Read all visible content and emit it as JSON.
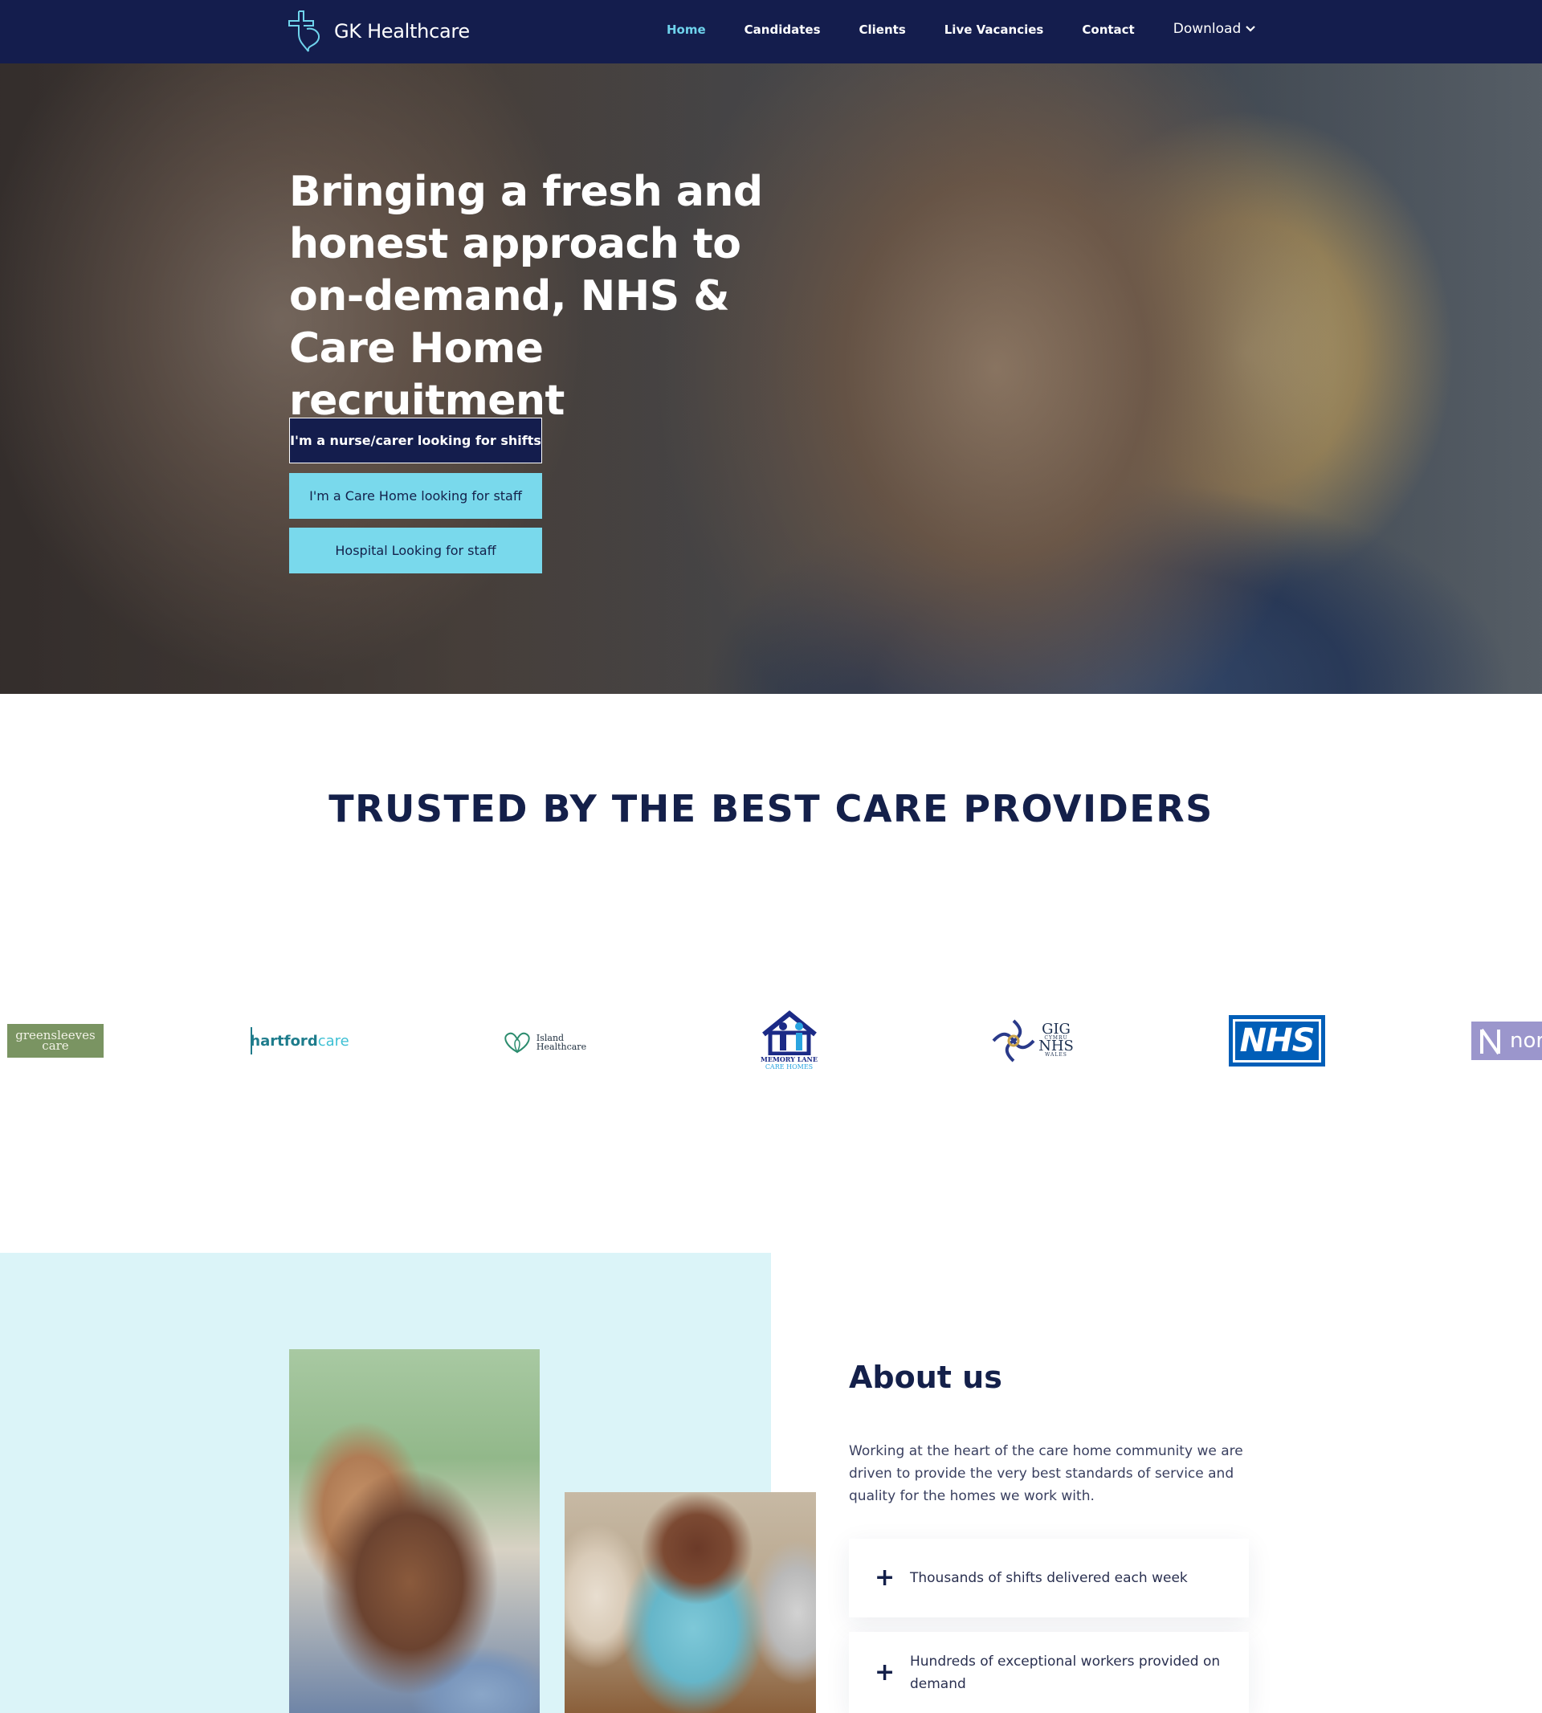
{
  "nav": {
    "brand": "GK Healthcare",
    "items": [
      {
        "label": "Home",
        "active": true
      },
      {
        "label": "Candidates"
      },
      {
        "label": "Clients"
      },
      {
        "label": "Live Vacancies"
      },
      {
        "label": "Contact"
      }
    ],
    "download": "Download",
    "icons": {
      "logo": "caduceus-cross-icon",
      "dropdown": "chevron-down-icon"
    }
  },
  "hero": {
    "title": "Bringing a fresh and honest approach to on-demand, NHS & Care Home recruitment",
    "buttons": [
      "I'm a nurse/carer looking for shifts",
      "I'm a Care Home looking for staff",
      "Hospital Looking for staff"
    ]
  },
  "trusted": {
    "heading": "TRUSTED BY THE BEST CARE PROVIDERS",
    "logos": {
      "greensleeves": [
        "greensleeves",
        "care"
      ],
      "hartford": [
        "hartford",
        "care"
      ],
      "island": [
        "Island",
        "Healthcare"
      ],
      "memory_lane": [
        "MEMORY LANE",
        "CARE HOMES"
      ],
      "gig": [
        "GIG",
        "CYMRU",
        "NHS",
        "WALES"
      ],
      "nhs": "NHS",
      "nor": "nor"
    }
  },
  "about": {
    "title": "About us",
    "text": "Working at the heart of the care home community we are driven to provide the very best standards of service and quality for the homes we work with.",
    "features": [
      "Thousands of shifts delivered each week",
      "Hundreds of exceptional workers provided on demand"
    ]
  },
  "colors": {
    "navy": "#141d4d",
    "accent": "#79d9ec",
    "light_bg": "#dbf4f8",
    "nhs_blue": "#005eb8"
  }
}
